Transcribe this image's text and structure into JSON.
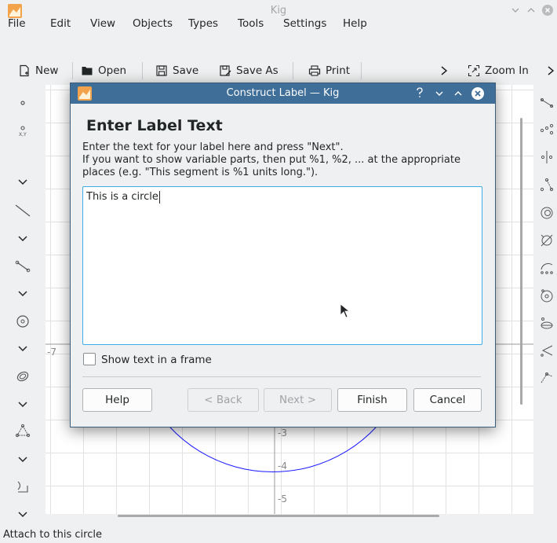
{
  "window": {
    "title": "Kig"
  },
  "menu": [
    "File",
    "Edit",
    "View",
    "Objects",
    "Types",
    "Tools",
    "Settings",
    "Help"
  ],
  "toolbar": {
    "new": "New",
    "open": "Open",
    "save": "Save",
    "save_as": "Save As",
    "print": "Print",
    "zoom_in": "Zoom In"
  },
  "canvas": {
    "axis_labels": [
      "-7",
      "-3",
      "-4",
      "-5"
    ],
    "circle_color": "#1a1aff"
  },
  "status": {
    "text": "Attach to this circle"
  },
  "dialog": {
    "title": "Construct Label — Kig",
    "heading": "Enter Label Text",
    "instructions": [
      "Enter the text for your label here and press \"Next\".",
      "If you want to show variable parts, then put %1, %2, ... at the appropriate",
      "places (e.g. \"This segment is %1 units long.\")."
    ],
    "label_value": "This is a circle",
    "show_frame_label": "Show text in a frame",
    "show_frame_checked": false,
    "buttons": {
      "help": "Help",
      "back": "< Back",
      "next": "Next >",
      "finish": "Finish",
      "cancel": "Cancel"
    }
  },
  "colors": {
    "accent": "#3daee9",
    "dialog_titlebar": "#3f6e99"
  }
}
